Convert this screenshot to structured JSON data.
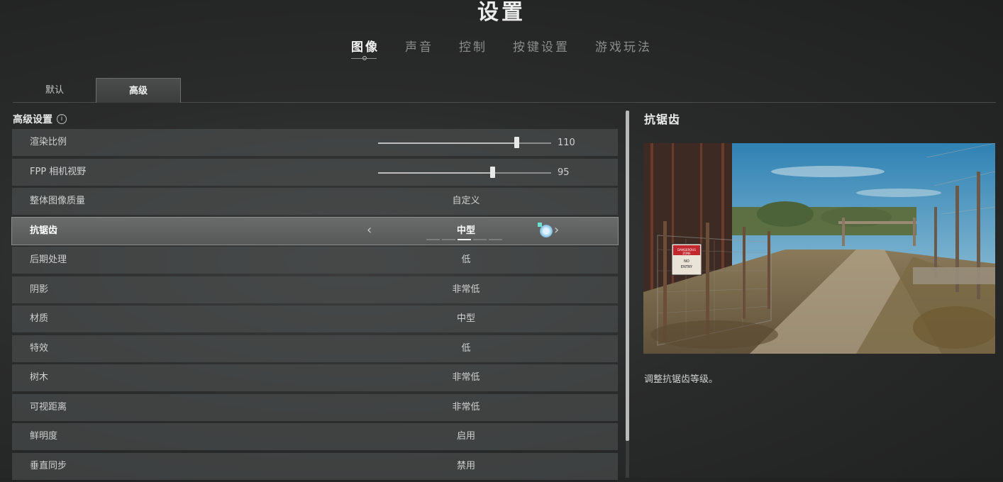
{
  "title": "设置",
  "tabs": [
    {
      "label": "图像",
      "active": true
    },
    {
      "label": "声音",
      "active": false
    },
    {
      "label": "控制",
      "active": false
    },
    {
      "label": "按键设置",
      "active": false
    },
    {
      "label": "游戏玩法",
      "active": false
    }
  ],
  "subtabs": [
    {
      "label": "默认",
      "active": false
    },
    {
      "label": "高级",
      "active": true
    }
  ],
  "section": {
    "label": "高级设置",
    "info_icon": "i"
  },
  "rows": [
    {
      "label": "渲染比例",
      "type": "slider",
      "value": "110",
      "fraction": 0.8
    },
    {
      "label": "FPP 相机视野",
      "type": "slider",
      "value": "95",
      "fraction": 0.66
    },
    {
      "label": "整体图像质量",
      "type": "value",
      "value": "自定义"
    },
    {
      "label": "抗锯齿",
      "type": "selector",
      "value": "中型",
      "level": 3,
      "levels": 5,
      "selected": true,
      "left_arrow": "‹",
      "right_arrow": "›"
    },
    {
      "label": "后期处理",
      "type": "value",
      "value": "低"
    },
    {
      "label": "阴影",
      "type": "value",
      "value": "非常低"
    },
    {
      "label": "材质",
      "type": "value",
      "value": "中型"
    },
    {
      "label": "特效",
      "type": "value",
      "value": "低"
    },
    {
      "label": "树木",
      "type": "value",
      "value": "非常低"
    },
    {
      "label": "可视距离",
      "type": "value",
      "value": "非常低"
    },
    {
      "label": "鲜明度",
      "type": "value",
      "value": "启用"
    },
    {
      "label": "垂直同步",
      "type": "value",
      "value": "禁用"
    }
  ],
  "detail": {
    "title": "抗锯齿",
    "description": "调整抗锯齿等级。",
    "sign_lines": [
      "DANGEROUS",
      "ZONE",
      "NO",
      "ENTRY"
    ]
  },
  "colors": {
    "background": "#2a2b2b",
    "selected_row": "#616362",
    "text": "#d0d0d0",
    "accent": "#f0f0f0"
  }
}
